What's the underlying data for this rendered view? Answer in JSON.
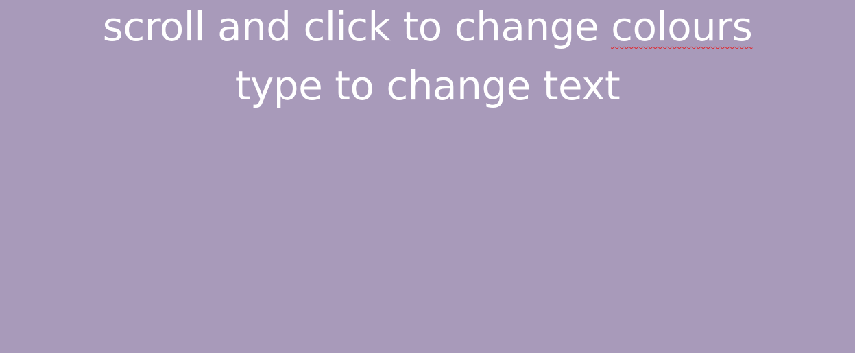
{
  "background_color": "#a89aba",
  "text_color": "#ffffff",
  "spellcheck_underline_color": "#e0242b",
  "editor": {
    "line1_prefix": "scroll and click to change ",
    "line1_misspelled": "colours",
    "line2": "type to change text"
  }
}
